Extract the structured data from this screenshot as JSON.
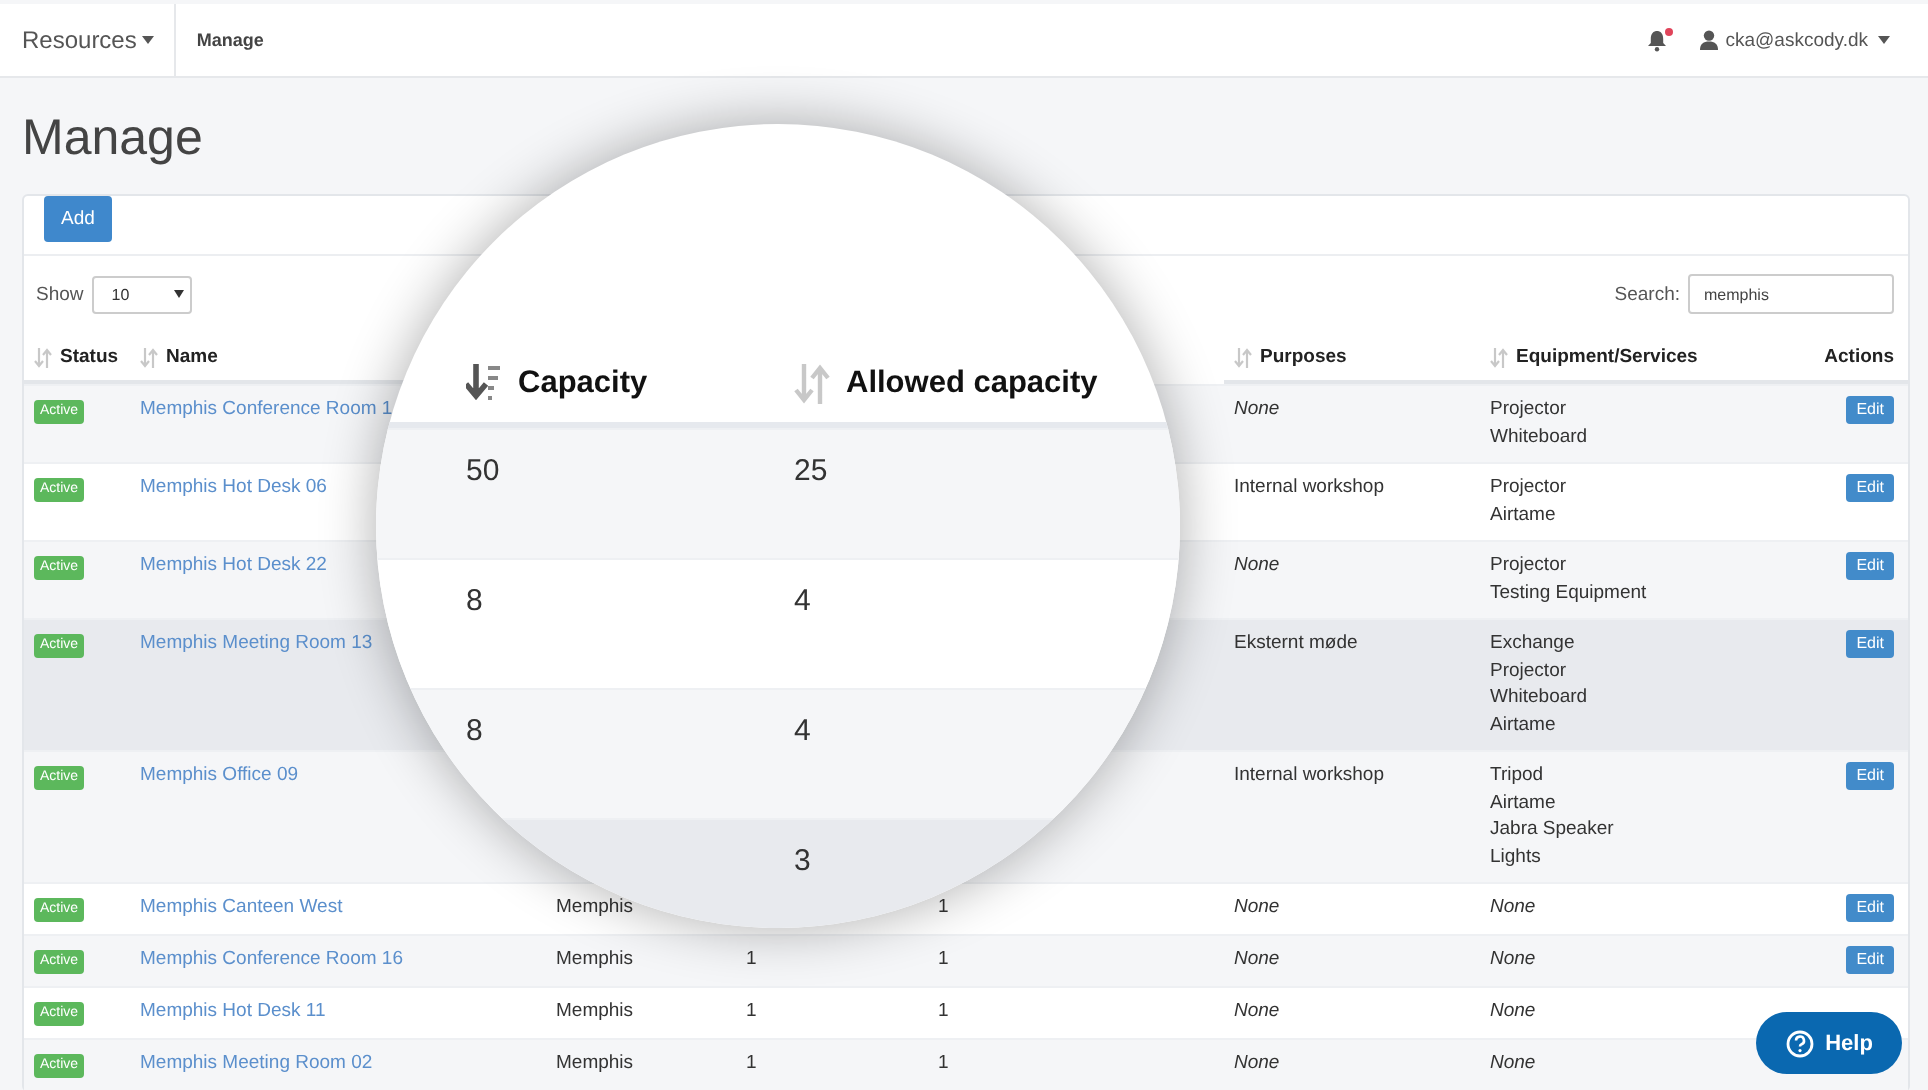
{
  "navbar": {
    "menu": {
      "label": "Resources"
    },
    "breadcrumb": "Manage",
    "notifications": {
      "unread": true
    },
    "user": {
      "email": "cka@askcody.dk"
    }
  },
  "page_title": "Manage",
  "toolbar": {
    "add_button": "Add",
    "show_label": "Show",
    "page_size": "10",
    "search_label": "Search:",
    "search_value": "memphis"
  },
  "table": {
    "columns": [
      {
        "label": "Status",
        "sortable": true
      },
      {
        "label": "Name",
        "sortable": true
      },
      {
        "label": "Purposes",
        "sortable": true
      },
      {
        "label": "Equipment/Services",
        "sortable": true
      },
      {
        "label": "Actions",
        "sortable": false
      }
    ],
    "rows": [
      {
        "status": {
          "label": "Active",
          "kind": "active"
        },
        "name": "Memphis Conference Room 1",
        "purposes": {
          "text": "None",
          "empty": true
        },
        "equipment": {
          "items": [
            "Projector",
            "Whiteboard"
          ],
          "empty": false
        },
        "action": "Edit",
        "highlighted": false
      },
      {
        "status": {
          "label": "Active",
          "kind": "active"
        },
        "name": "Memphis Hot Desk 06",
        "purposes": {
          "text": "Internal workshop",
          "empty": false
        },
        "equipment": {
          "items": [
            "Projector",
            "Airtame"
          ],
          "empty": false
        },
        "action": "Edit",
        "highlighted": false
      },
      {
        "status": {
          "label": "Active",
          "kind": "active"
        },
        "name": "Memphis Hot Desk 22",
        "purposes": {
          "text": "None",
          "empty": true
        },
        "equipment": {
          "items": [
            "Projector",
            "Testing Equipment"
          ],
          "empty": false
        },
        "action": "Edit",
        "highlighted": false
      },
      {
        "status": {
          "label": "Active",
          "kind": "active"
        },
        "name": "Memphis Meeting Room 13",
        "purposes": {
          "text": "Eksternt møde",
          "empty": false
        },
        "equipment": {
          "items": [
            "Exchange",
            "Projector",
            "Whiteboard",
            "Airtame"
          ],
          "empty": false
        },
        "action": "Edit",
        "highlighted": true
      },
      {
        "status": {
          "label": "Active",
          "kind": "active"
        },
        "name": "Memphis Office 09",
        "purposes": {
          "text": "Internal workshop",
          "empty": false
        },
        "equipment": {
          "items": [
            "Tripod",
            "Airtame",
            "Jabra Speaker",
            "Lights"
          ],
          "empty": false
        },
        "action": "Edit",
        "highlighted": false
      },
      {
        "status": {
          "label": "Active",
          "kind": "active"
        },
        "name": "Memphis Canteen West",
        "location": "Memphis",
        "allowed_capacity": "1",
        "purposes": {
          "text": "None",
          "empty": true
        },
        "equipment": {
          "items": [
            "None"
          ],
          "empty": true
        },
        "action": "Edit",
        "highlighted": false
      },
      {
        "status": {
          "label": "Active",
          "kind": "active"
        },
        "name": "Memphis Conference Room 16",
        "location": "Memphis",
        "capacity": "1",
        "allowed_capacity": "1",
        "purposes": {
          "text": "None",
          "empty": true
        },
        "equipment": {
          "items": [
            "None"
          ],
          "empty": true
        },
        "action": "Edit",
        "highlighted": false
      },
      {
        "status": {
          "label": "Active",
          "kind": "active"
        },
        "name": "Memphis Hot Desk 11",
        "location": "Memphis",
        "capacity": "1",
        "allowed_capacity": "1",
        "purposes": {
          "text": "None",
          "empty": true
        },
        "equipment": {
          "items": [
            "None"
          ],
          "empty": true
        },
        "highlighted": false
      },
      {
        "status": {
          "label": "Active",
          "kind": "active"
        },
        "name": "Memphis Meeting Room 02",
        "location": "Memphis",
        "capacity": "1",
        "allowed_capacity": "1",
        "purposes": {
          "text": "None",
          "empty": true
        },
        "equipment": {
          "items": [
            "None"
          ],
          "empty": true
        },
        "highlighted": false
      }
    ]
  },
  "magnifier": {
    "columns": [
      {
        "label": "Capacity",
        "sorted_descending": true
      },
      {
        "label": "Allowed capacity",
        "sorted_descending": false
      }
    ],
    "rows": [
      {
        "capacity": "50",
        "allowed_capacity": "25",
        "highlighted": false
      },
      {
        "capacity": "8",
        "allowed_capacity": "4",
        "highlighted": false
      },
      {
        "capacity": "8",
        "allowed_capacity": "4",
        "highlighted": false
      },
      {
        "allowed_capacity": "3",
        "highlighted": true
      }
    ]
  },
  "help_button": "Help"
}
